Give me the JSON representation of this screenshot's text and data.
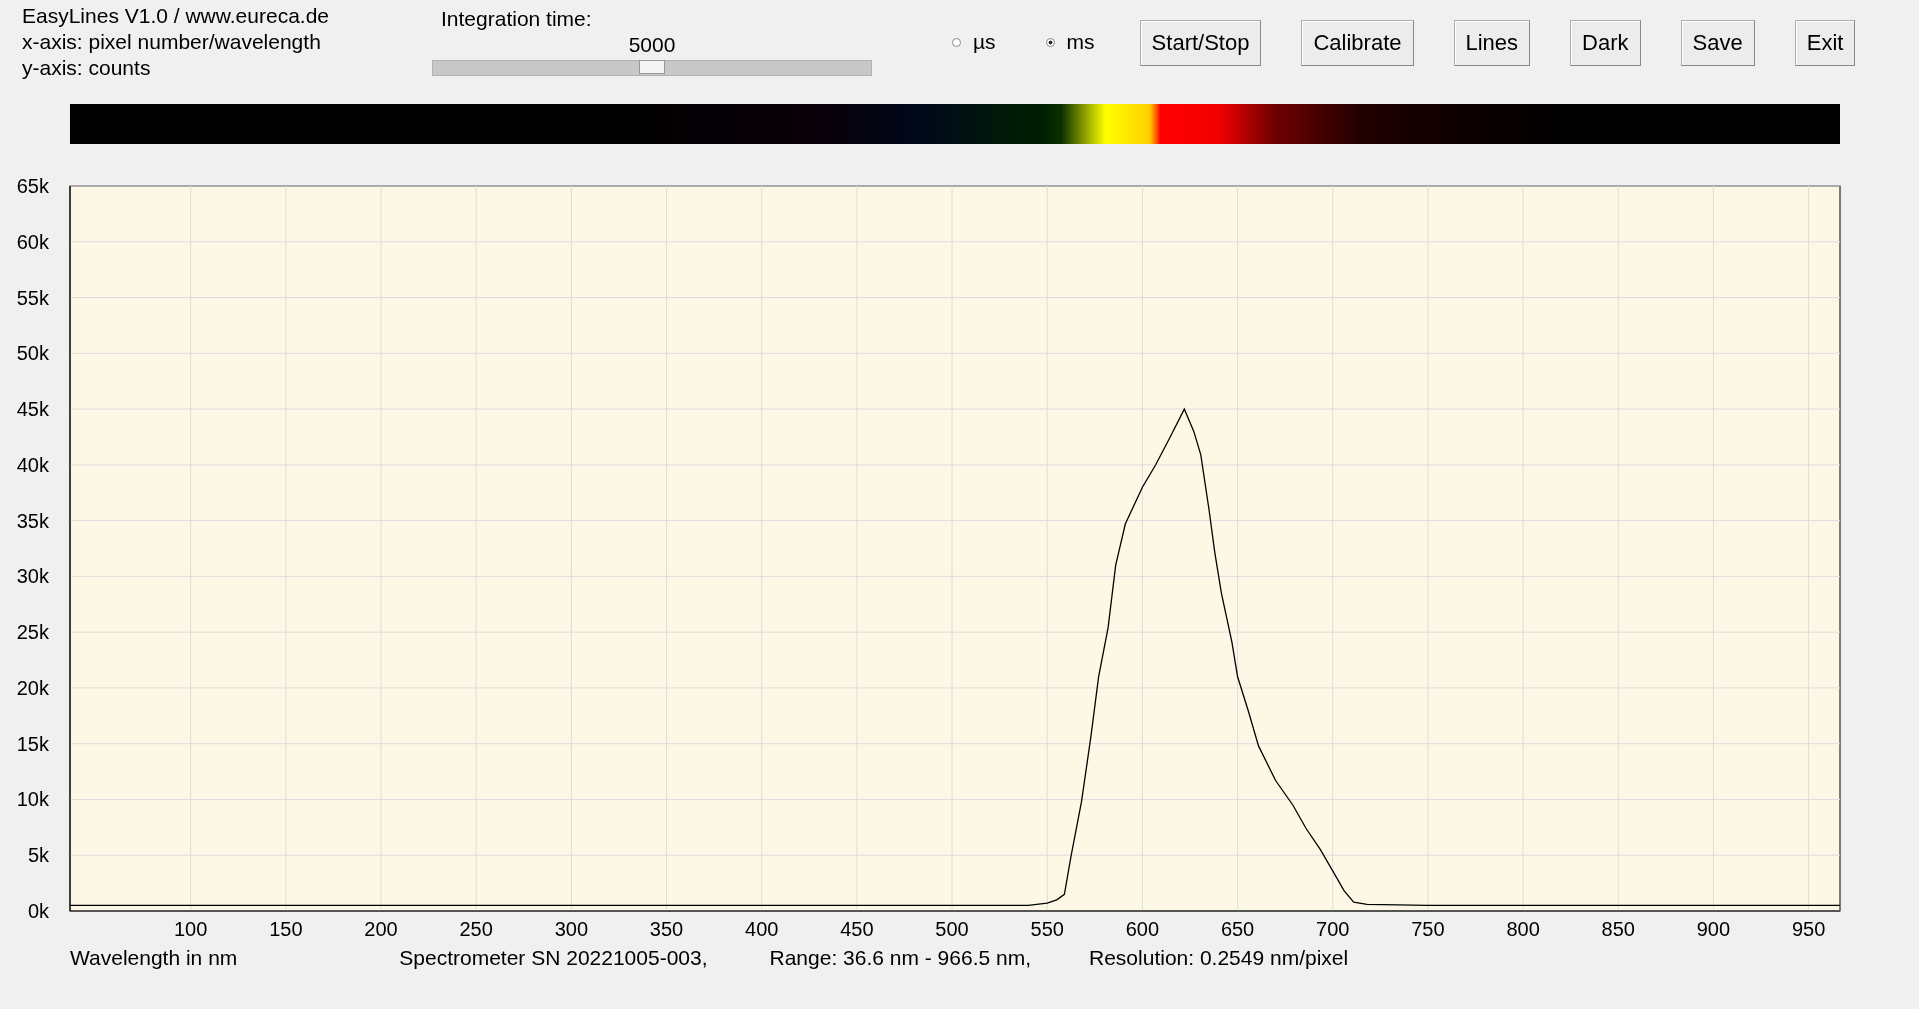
{
  "info_lines": [
    "EasyLines V1.0 / www.eureca.de",
    "x-axis: pixel number/wavelength",
    "y-axis: counts"
  ],
  "integration": {
    "label": "Integration time:",
    "value": "5000",
    "level": 0.5
  },
  "units": [
    {
      "label": "µs",
      "selected": false
    },
    {
      "label": "ms",
      "selected": true
    }
  ],
  "buttons": [
    "Start/Stop",
    "Calibrate",
    "Lines",
    "Dark",
    "Save",
    "Exit"
  ],
  "chart": {
    "chart_data": {
      "type": "line",
      "grid": true,
      "xlim": [
        36.6,
        966.5
      ],
      "ylim": [
        0,
        65000
      ],
      "xticks": [
        100,
        150,
        200,
        250,
        300,
        350,
        400,
        450,
        500,
        550,
        600,
        650,
        700,
        750,
        800,
        850,
        900,
        950
      ],
      "yticks": [
        {
          "value": 0,
          "label": "0k"
        },
        {
          "value": 5000,
          "label": "5k"
        },
        {
          "value": 10000,
          "label": "10k"
        },
        {
          "value": 15000,
          "label": "15k"
        },
        {
          "value": 20000,
          "label": "20k"
        },
        {
          "value": 25000,
          "label": "25k"
        },
        {
          "value": 30000,
          "label": "30k"
        },
        {
          "value": 35000,
          "label": "35k"
        },
        {
          "value": 40000,
          "label": "40k"
        },
        {
          "value": 45000,
          "label": "45k"
        },
        {
          "value": 50000,
          "label": "50k"
        },
        {
          "value": 55000,
          "label": "55k"
        },
        {
          "value": 60000,
          "label": "60k"
        },
        {
          "value": 65000,
          "label": "65k"
        }
      ],
      "x": [
        36.6,
        100,
        200,
        300,
        400,
        500,
        540,
        550,
        555,
        559,
        562.5,
        568,
        573,
        577,
        582,
        586,
        591,
        600,
        607,
        614.6,
        622,
        627,
        630.7,
        635,
        638,
        641.5,
        647,
        650,
        655.7,
        661,
        670,
        679,
        686,
        693.5,
        700,
        706,
        711,
        718,
        750,
        800,
        900,
        966.5
      ],
      "series": [
        {
          "color": "#000000",
          "values": [
            500,
            500,
            500,
            500,
            500,
            500,
            500,
            700,
            1000,
            1500,
            4900,
            9800,
            15700,
            21000,
            25400,
            31000,
            34700,
            38000,
            40000,
            42500,
            45000,
            43000,
            40900,
            36000,
            32200,
            28500,
            24100,
            21000,
            17900,
            14800,
            11700,
            9500,
            7400,
            5500,
            3600,
            1800,
            800,
            600,
            500,
            500,
            500,
            500
          ]
        }
      ]
    },
    "footer": [
      "Wavelength in nm",
      "Spectrometer SN 20221005-003,",
      "Range: 36.6 nm - 966.5 nm,",
      "Resolution: 0.2549 nm/pixel"
    ]
  }
}
